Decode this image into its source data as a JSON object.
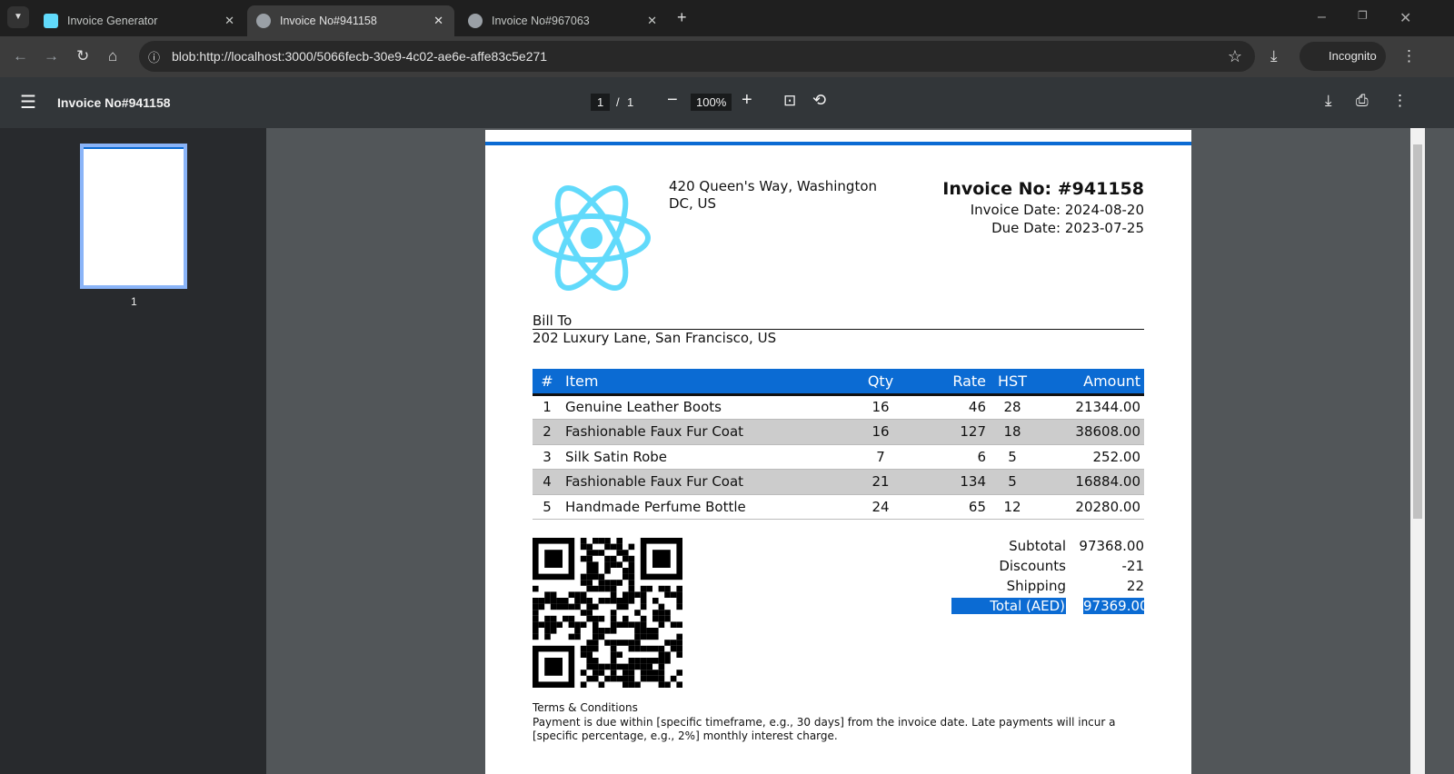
{
  "tabs": [
    {
      "label": "Invoice Generator"
    },
    {
      "label": "Invoice No#941158"
    },
    {
      "label": "Invoice No#967063"
    }
  ],
  "address": {
    "url": "blob:http://localhost:3000/5066fecb-30e9-4c02-ae6e-affe83c5e271",
    "profile": "Incognito"
  },
  "viewer": {
    "title": "Invoice No#941158",
    "page": "1",
    "pages": "1",
    "zoom": "100%",
    "thumb_label": "1"
  },
  "invoice": {
    "address": "420 Queen's Way, Washington DC, US",
    "number": "Invoice No: #941158",
    "invoice_date": "Invoice Date: 2024-08-20",
    "due_date": "Due Date: 2023-07-25",
    "bill_to_label": "Bill To",
    "bill_to": "202 Luxury Lane, San Francisco, US",
    "headers": [
      "#",
      "Item",
      "Qty",
      "Rate",
      "HST",
      "Amount"
    ],
    "rows": [
      [
        "1",
        "Genuine Leather Boots",
        "16",
        "46",
        "28",
        "21344.00"
      ],
      [
        "2",
        "Fashionable Faux Fur Coat",
        "16",
        "127",
        "18",
        "38608.00"
      ],
      [
        "3",
        "Silk Satin Robe",
        "7",
        "6",
        "5",
        "252.00"
      ],
      [
        "4",
        "Fashionable Faux Fur Coat",
        "21",
        "134",
        "5",
        "16884.00"
      ],
      [
        "5",
        "Handmade Perfume Bottle",
        "24",
        "65",
        "12",
        "20280.00"
      ]
    ],
    "totals": {
      "subtotal_label": "Subtotal",
      "subtotal": "97368.00",
      "discounts_label": "Discounts",
      "discounts": "-21",
      "shipping_label": "Shipping",
      "shipping": "22",
      "total_label": "Total (AED)",
      "total": "97369.00"
    },
    "terms_title": "Terms & Conditions",
    "terms": "Payment is due within [specific timeframe, e.g., 30 days] from the invoice date. Late payments will incur a [specific percentage, e.g., 2%] monthly interest charge."
  },
  "colors": {
    "accent": "#0b6bd3",
    "react": "#61dafb"
  }
}
